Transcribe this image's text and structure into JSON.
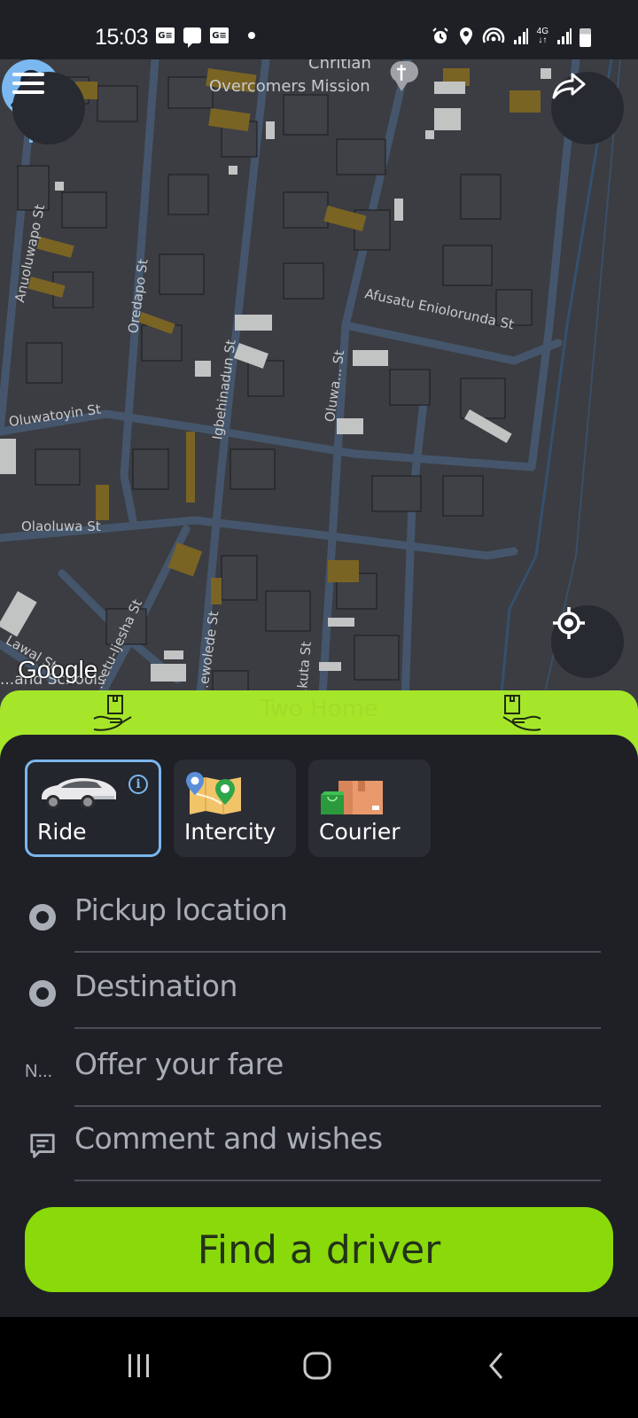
{
  "status_bar": {
    "time": "15:03",
    "left_icons": [
      "google-news-icon",
      "message-icon",
      "google-news-icon",
      "notification-dot"
    ],
    "right_icons": [
      "alarm-icon",
      "location-icon",
      "hotspot-icon",
      "signal-icon",
      "4g-data-icon",
      "signal-icon",
      "battery-icon"
    ],
    "network_label": "4G"
  },
  "map": {
    "provider": "Google",
    "poi": {
      "name_line1": "Chritian",
      "name_line2": "Overcomers Mission"
    },
    "streets": [
      "Anuoluwapo St",
      "Oredapo St",
      "Igbehinadun St",
      "Oluwatoyin St",
      "Afusatu Eniolorunda St",
      "Oluwa... St",
      "Olaoluwa St",
      "...etu-Ijesha St",
      "...ewolede St",
      "...kuta St",
      "Lawal St",
      "...and Schools"
    ],
    "buttons": {
      "menu": "menu-icon",
      "share": "share-icon",
      "locate": "my-location-icon"
    }
  },
  "promo_banner": {
    "text": "Two Home"
  },
  "services": [
    {
      "label": "Ride",
      "icon": "car-icon",
      "selected": true,
      "has_info": true,
      "info_glyph": "i"
    },
    {
      "label": "Intercity",
      "icon": "map-pins-icon",
      "selected": false
    },
    {
      "label": "Courier",
      "icon": "package-icon",
      "selected": false
    }
  ],
  "form": {
    "pickup": {
      "placeholder": "Pickup location",
      "icon": "pickup-dot-icon"
    },
    "destination": {
      "placeholder": "Destination",
      "icon": "destination-dot-icon"
    },
    "fare": {
      "placeholder": "Offer your fare",
      "currency_prefix": "N..."
    },
    "comment": {
      "placeholder": "Comment and wishes",
      "icon": "comment-icon"
    }
  },
  "cta": {
    "label": "Find a driver"
  },
  "colors": {
    "accent_green": "#8ad90a",
    "banner_green": "#a6e62a",
    "selected_border": "#7bb6ee",
    "panel_bg": "#1e2026"
  },
  "nav_bar": {
    "recents": "recents-icon",
    "home": "home-icon",
    "back": "back-icon"
  }
}
